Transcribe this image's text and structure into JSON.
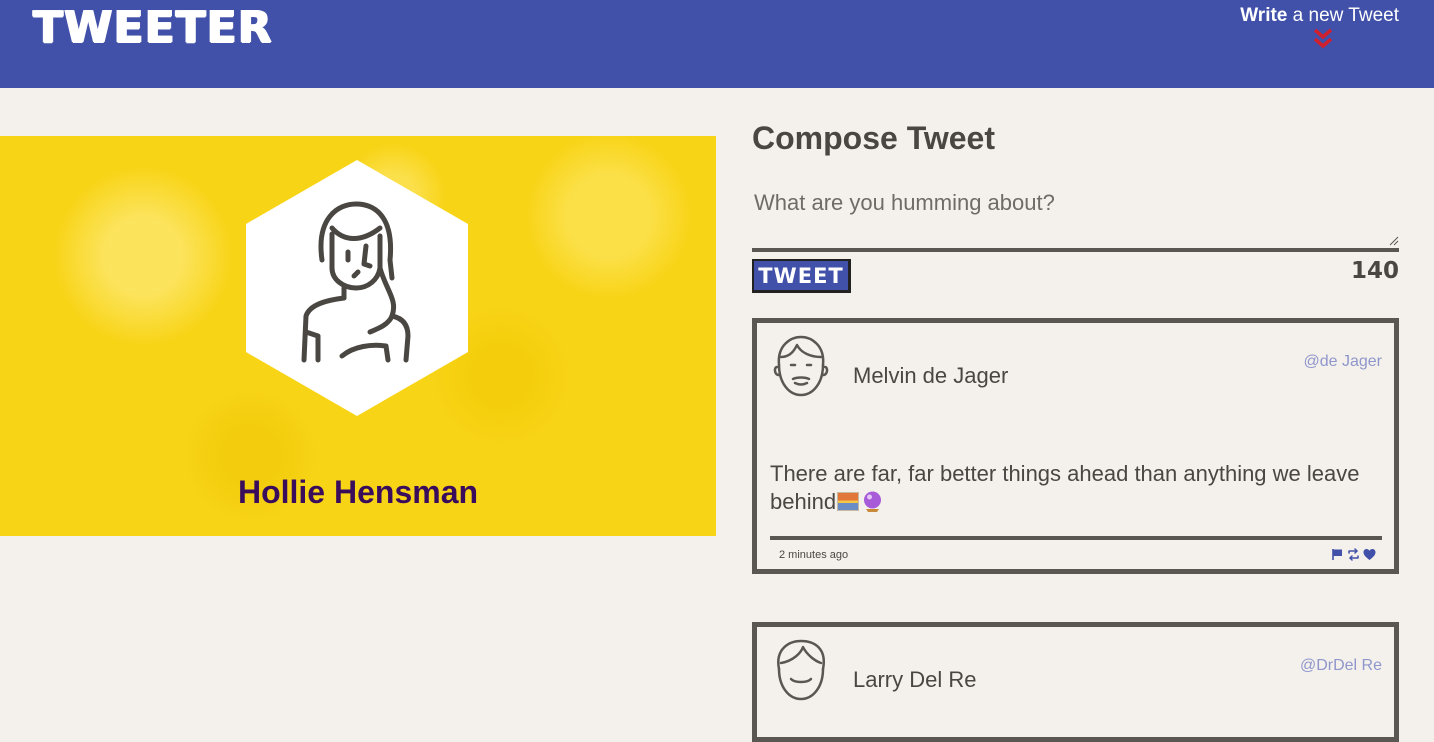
{
  "header": {
    "logo": "TWEETER",
    "write_strong": "Write",
    "write_rest": " a new Tweet",
    "chevron_icon": "double-chevron-down-icon",
    "background": "#4150a8",
    "chevron_color": "#d0202e"
  },
  "profile": {
    "name": "Hollie Hensman",
    "avatar_icon": "woman-avatar-icon",
    "banner_color": "#f8d417",
    "name_color": "#3a0d5c"
  },
  "compose": {
    "title": "Compose Tweet",
    "placeholder": "What are you humming about?",
    "button_label": "TWEET",
    "counter": "140"
  },
  "tweets": [
    {
      "author": "Melvin de Jager",
      "handle": "@de Jager",
      "avatar_icon": "man-avatar-icon",
      "text": "There are far, far better things ahead than anything we leave behind",
      "emojis": [
        "sunrise-emoji",
        "crystal-ball-emoji"
      ],
      "time": "2 minutes ago",
      "actions": [
        "flag-icon",
        "retweet-icon",
        "heart-icon"
      ]
    },
    {
      "author": "Larry Del Re",
      "handle": "@DrDel Re",
      "avatar_icon": "boy-avatar-icon"
    }
  ]
}
